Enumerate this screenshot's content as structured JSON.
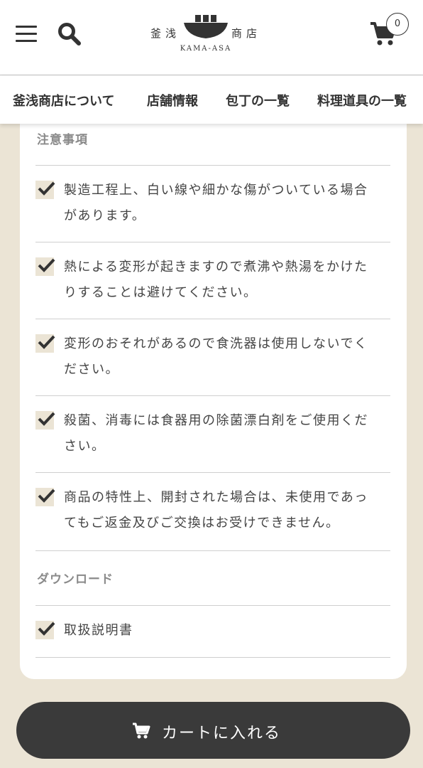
{
  "header": {
    "logo_left": "釜浅",
    "logo_right": "商店",
    "logo_latin": "KAMA-ASA",
    "cart_count": "0",
    "icons": [
      "menu-icon",
      "search-icon",
      "cart-icon"
    ]
  },
  "nav": {
    "items": [
      {
        "label": "釜浅商店について"
      },
      {
        "label": "店舗情報"
      },
      {
        "label": "包丁の一覧"
      },
      {
        "label": "料理道具の一覧"
      }
    ]
  },
  "notes": {
    "heading": "注意事項",
    "items": [
      {
        "line1": "製造工程上、白い線や細かな傷がついている場合",
        "line2": "があります。"
      },
      {
        "line1": "熱による変形が起きますので煮沸や熱湯をかけた",
        "line2": "りすることは避けてください。"
      },
      {
        "line1": "変形のおそれがあるので食洗器は使用しないでく",
        "line2": "ださい。"
      },
      {
        "line1": "殺菌、消毒には食器用の除菌漂白剤をご使用くだ",
        "line2": "さい。"
      },
      {
        "line1": "商品の特性上、開封された場合は、未使用であっ",
        "line2": "てもご返金及びご交換はお受けできません。"
      }
    ]
  },
  "download": {
    "heading": "ダウンロード",
    "items": [
      {
        "label": "取扱説明書"
      }
    ]
  },
  "add_to_cart": {
    "label": "カートに入れる"
  },
  "colors": {
    "background": "#ebe4d5",
    "button": "#3a3a3a",
    "text": "#333333"
  }
}
